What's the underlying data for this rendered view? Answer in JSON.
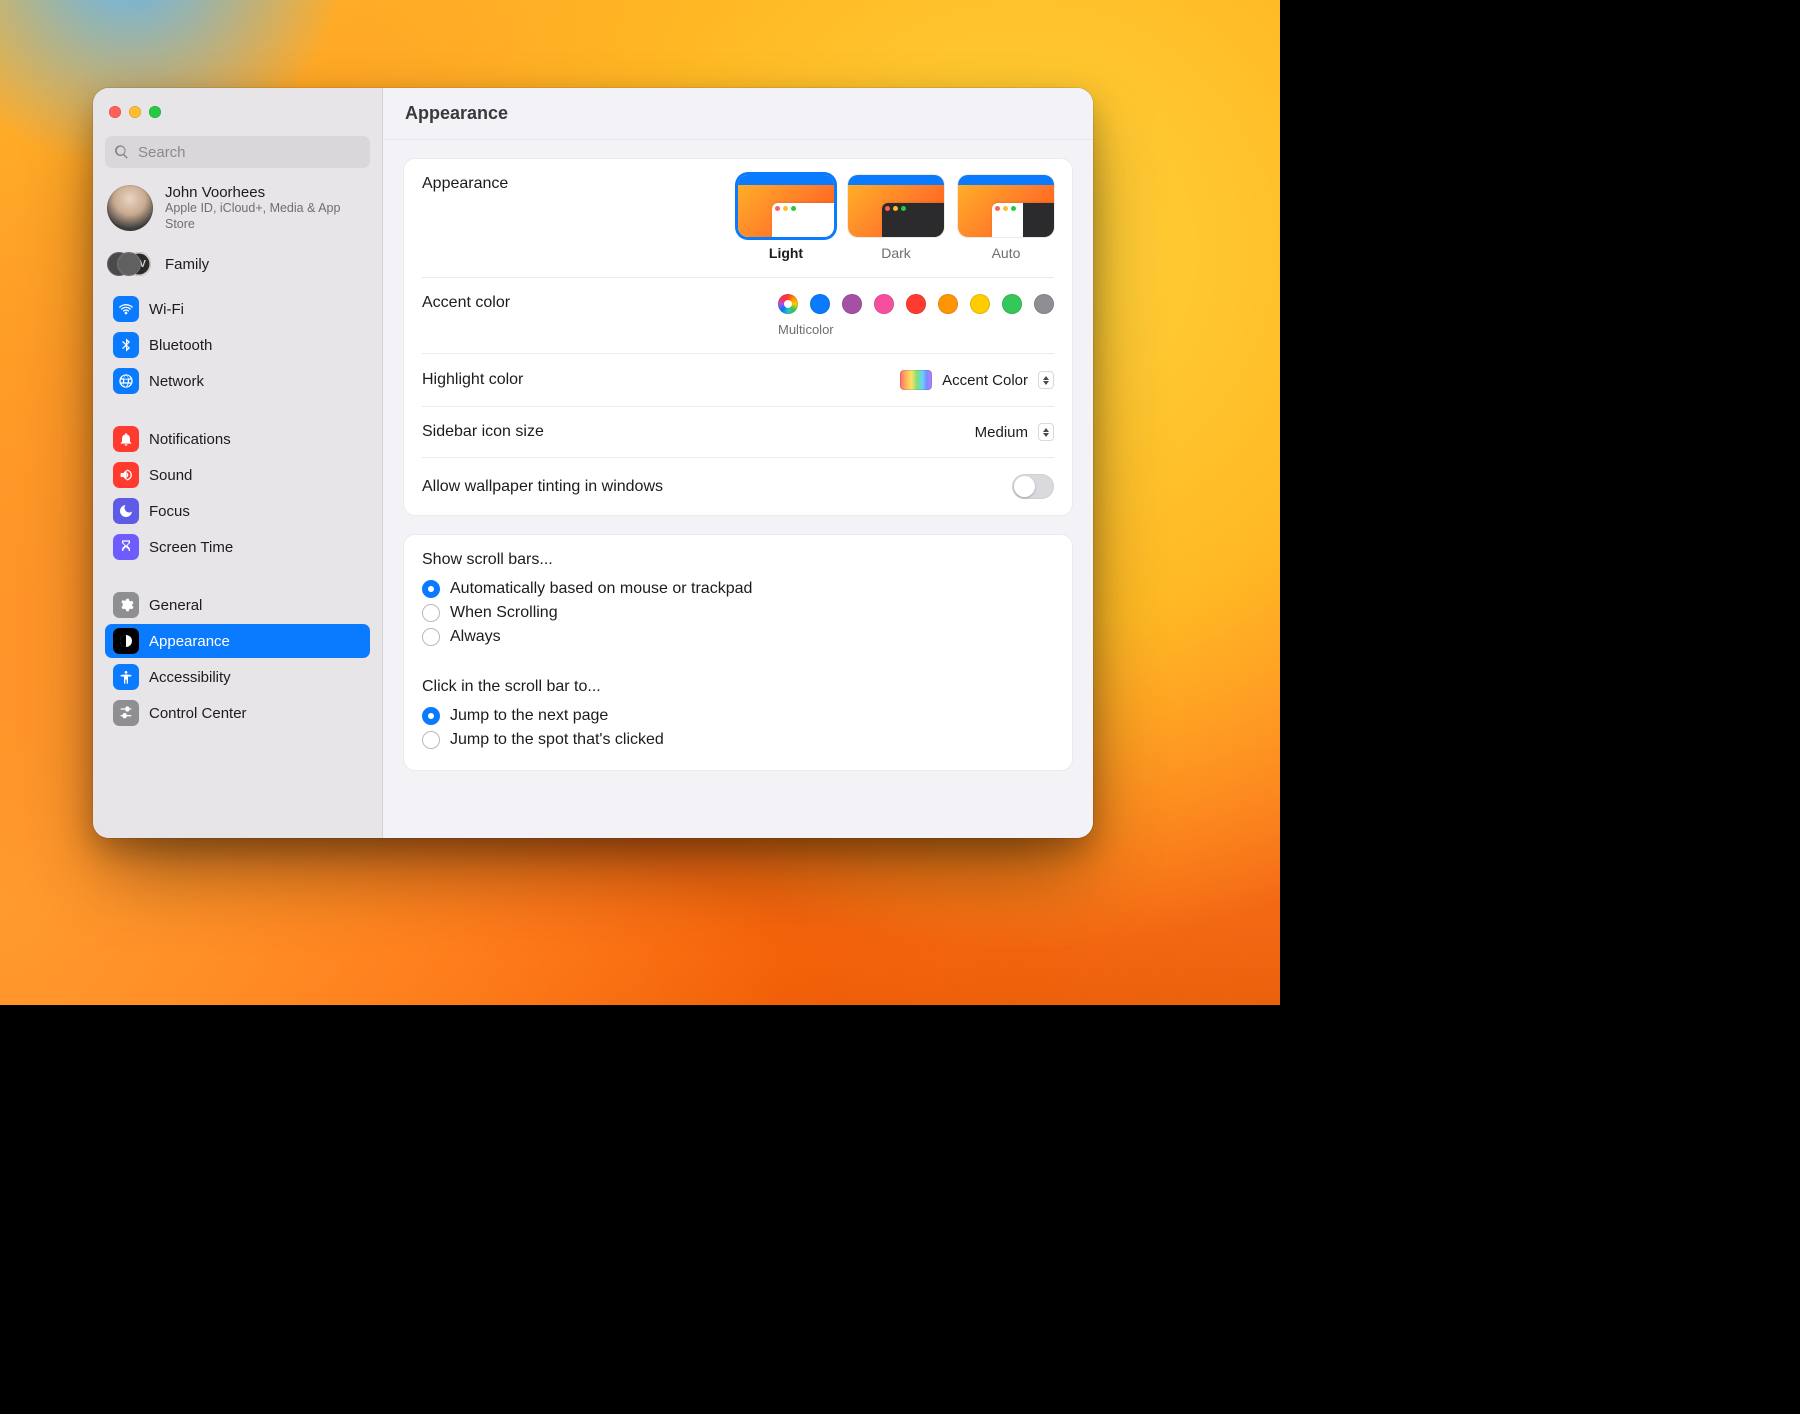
{
  "window": {
    "title": "Appearance"
  },
  "search": {
    "placeholder": "Search"
  },
  "account": {
    "name": "John Voorhees",
    "sub": "Apple ID, iCloud+, Media & App Store"
  },
  "family": {
    "label": "Family",
    "badge": "CV"
  },
  "sidebar": {
    "groups": [
      {
        "items": [
          {
            "id": "wifi",
            "label": "Wi-Fi"
          },
          {
            "id": "bluetooth",
            "label": "Bluetooth"
          },
          {
            "id": "network",
            "label": "Network"
          }
        ]
      },
      {
        "items": [
          {
            "id": "notifications",
            "label": "Notifications"
          },
          {
            "id": "sound",
            "label": "Sound"
          },
          {
            "id": "focus",
            "label": "Focus"
          },
          {
            "id": "screentime",
            "label": "Screen Time"
          }
        ]
      },
      {
        "items": [
          {
            "id": "general",
            "label": "General"
          },
          {
            "id": "appearance",
            "label": "Appearance",
            "selected": true
          },
          {
            "id": "accessibility",
            "label": "Accessibility"
          },
          {
            "id": "controlcenter",
            "label": "Control Center"
          }
        ]
      }
    ]
  },
  "appearance": {
    "section_label": "Appearance",
    "modes": [
      {
        "id": "light",
        "label": "Light",
        "selected": true
      },
      {
        "id": "dark",
        "label": "Dark"
      },
      {
        "id": "auto",
        "label": "Auto"
      }
    ],
    "accent": {
      "label": "Accent color",
      "selected": "multicolor",
      "caption": "Multicolor",
      "colors": [
        {
          "id": "multicolor",
          "hex": "multicolor"
        },
        {
          "id": "blue",
          "hex": "#0a7bff"
        },
        {
          "id": "purple",
          "hex": "#a550a7"
        },
        {
          "id": "pink",
          "hex": "#f74f9e"
        },
        {
          "id": "red",
          "hex": "#ff3b30"
        },
        {
          "id": "orange",
          "hex": "#ff9500"
        },
        {
          "id": "yellow",
          "hex": "#ffcc00"
        },
        {
          "id": "green",
          "hex": "#34c759"
        },
        {
          "id": "graphite",
          "hex": "#8e8e93"
        }
      ]
    },
    "highlight": {
      "label": "Highlight color",
      "value": "Accent Color"
    },
    "sidebar_icon": {
      "label": "Sidebar icon size",
      "value": "Medium"
    },
    "tinting": {
      "label": "Allow wallpaper tinting in windows",
      "value": true
    }
  },
  "scroll": {
    "show": {
      "label": "Show scroll bars...",
      "options": [
        {
          "id": "auto",
          "label": "Automatically based on mouse or trackpad",
          "checked": true
        },
        {
          "id": "scroll",
          "label": "When Scrolling"
        },
        {
          "id": "always",
          "label": "Always"
        }
      ]
    },
    "click": {
      "label": "Click in the scroll bar to...",
      "options": [
        {
          "id": "page",
          "label": "Jump to the next page",
          "checked": true
        },
        {
          "id": "spot",
          "label": "Jump to the spot that's clicked"
        }
      ]
    }
  }
}
